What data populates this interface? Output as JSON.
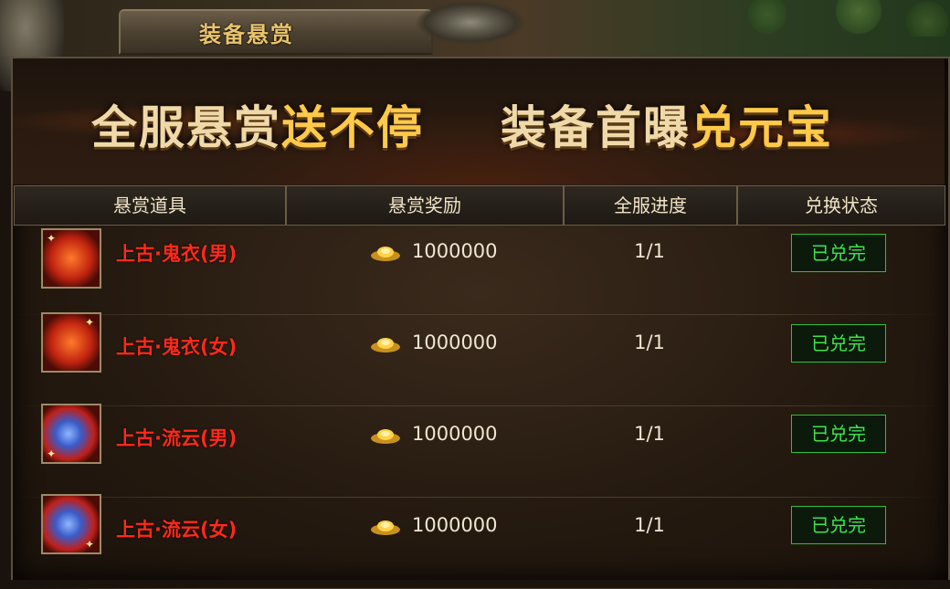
{
  "window": {
    "title": "装备悬赏"
  },
  "banner": {
    "left_a": "全服悬赏",
    "left_b": "送不停",
    "right_a": "装备首曝",
    "right_b": "兑元宝"
  },
  "table": {
    "headers": [
      "悬赏道具",
      "悬赏奖励",
      "全服进度",
      "兑换状态"
    ],
    "rows": [
      {
        "item": "上古·鬼衣(男)",
        "reward": "1000000",
        "progress": "1/1",
        "status": "已兑完"
      },
      {
        "item": "上古·鬼衣(女)",
        "reward": "1000000",
        "progress": "1/1",
        "status": "已兑完"
      },
      {
        "item": "上古·流云(男)",
        "reward": "1000000",
        "progress": "1/1",
        "status": "已兑完"
      },
      {
        "item": "上古·流云(女)",
        "reward": "1000000",
        "progress": "1/1",
        "status": "已兑完"
      }
    ]
  },
  "icons": {
    "reward": "gold-ingot-icon",
    "items": [
      "armor-icon",
      "armor-icon",
      "armor-icon",
      "armor-icon"
    ]
  },
  "colors": {
    "item_name": "#ff2a1a",
    "status_green": "#3be64a",
    "title_gold": "#e9c46c",
    "slogan_highlight": "#ffc94a"
  }
}
